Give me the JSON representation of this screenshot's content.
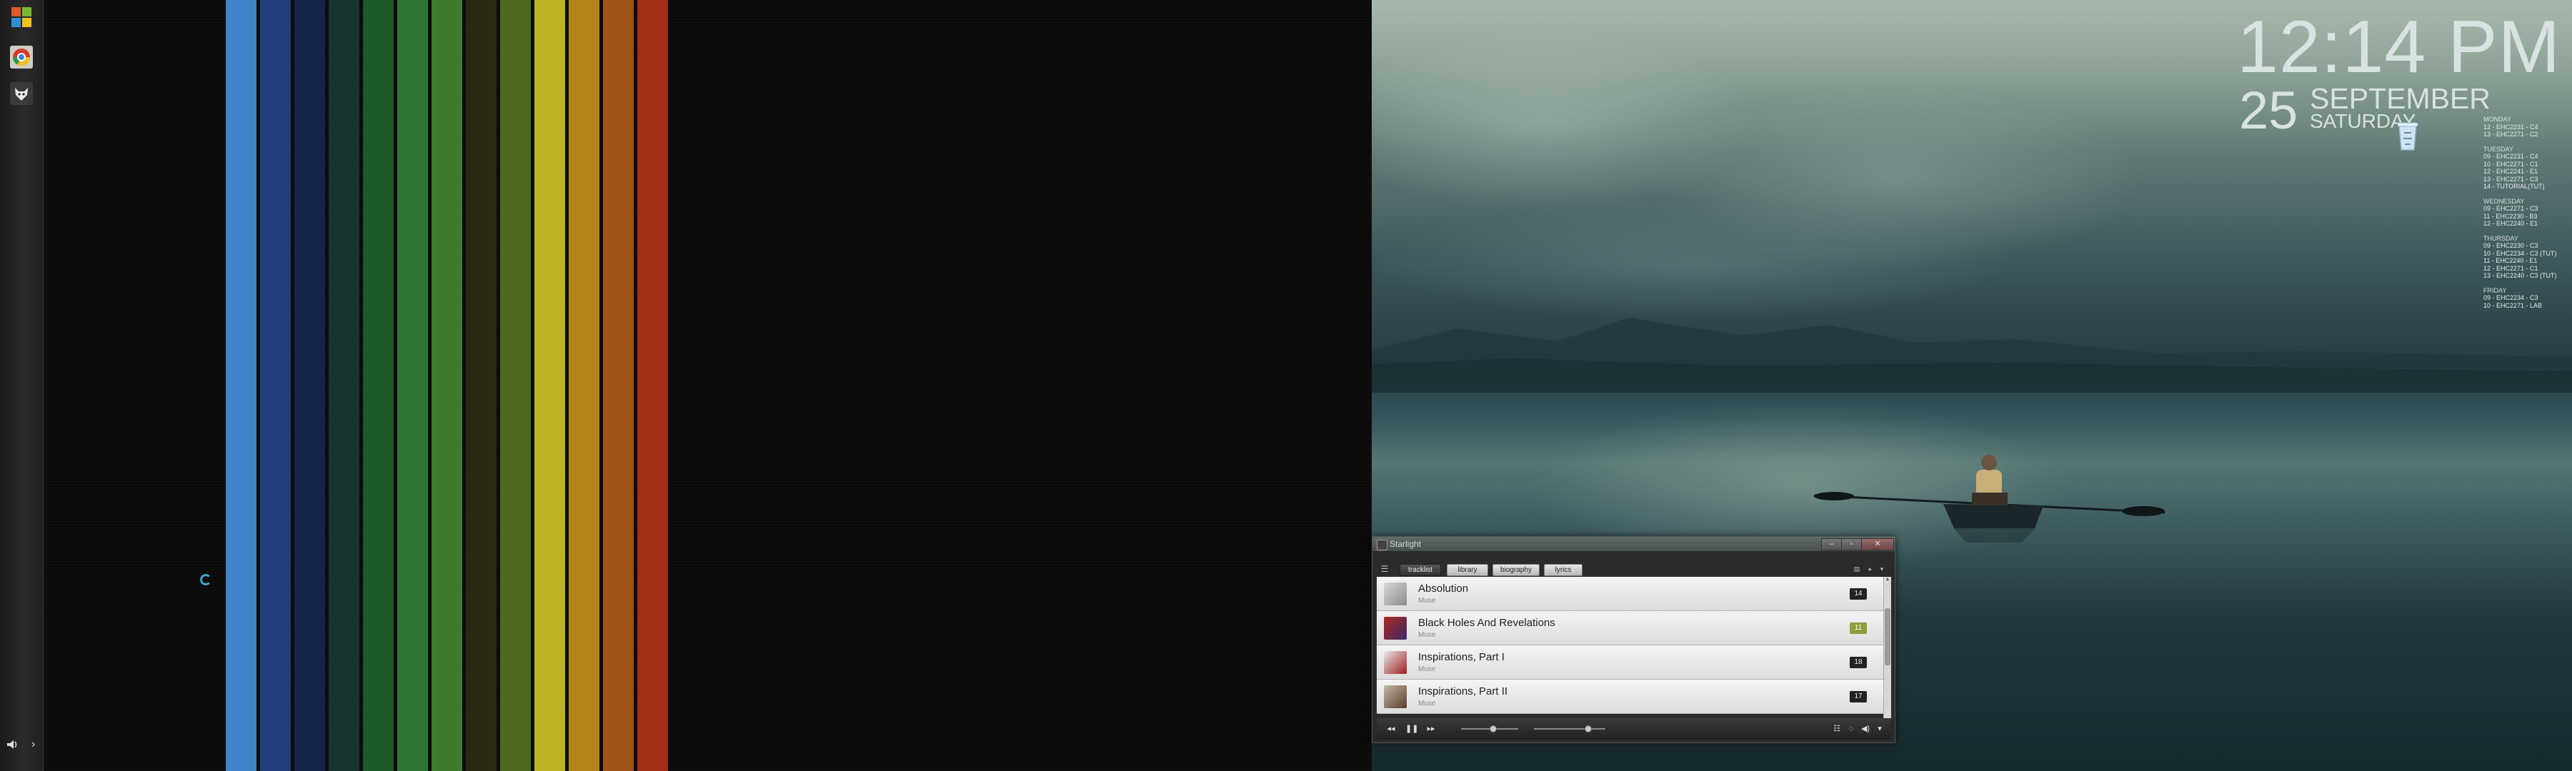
{
  "colors": {
    "stripes": [
      "#3e86c9",
      "#213e7e",
      "#15244b",
      "#16332d",
      "#1c5a2a",
      "#2f7633",
      "#3f7a2c",
      "#2a2a13",
      "#4d6b1c",
      "#bcb222",
      "#b38518",
      "#9f5316",
      "#a32e18"
    ],
    "accent_badge": "#8aa13c"
  },
  "taskbar": {
    "icons": [
      "windows-start-icon",
      "chrome-icon",
      "wolf-app-icon"
    ],
    "tray_volume_icon": "speaker-icon",
    "tray_arrow": "›"
  },
  "clock": {
    "time": "12:14 PM",
    "day": "25",
    "month": "SEPTEMBER",
    "weekday": "SATURDAY"
  },
  "desktop": {
    "icons": [
      "recycle-bin-icon"
    ]
  },
  "schedule": [
    {
      "day": "MONDAY",
      "lines": [
        "12 - EHC2231 - C4",
        "13 - EHC2271 - C2"
      ]
    },
    {
      "day": "TUESDAY",
      "lines": [
        "09 - EHC2231 - C4",
        "10 - EHC2271 - C1",
        "12 - EHC2241 - E1",
        "13 - EHC2271 - C3",
        "14 - TUTORIAL(TUT)"
      ]
    },
    {
      "day": "WEDNESDAY",
      "lines": [
        "09 - EHC2271 - C3",
        "11 - EHC2230 - B3",
        "12 - EHC2240 - E1"
      ]
    },
    {
      "day": "THURSDAY",
      "lines": [
        "09 - EHC2230 - C3",
        "10 - EHC2234 - C3 (TUT)",
        "11 - EHC2240 - E1",
        "12 - EHC2271 - C1",
        "13 - EHC2240 - C3 (TUT)"
      ]
    },
    {
      "day": "FRIDAY",
      "lines": [
        "09 - EHC2234 - C3",
        "10 - EHC2271 - LAB"
      ]
    }
  ],
  "player": {
    "title": "Starlight",
    "window_buttons": {
      "minimize": "–",
      "maximize": "▫",
      "close": "✕"
    },
    "tabs": [
      "tracklist",
      "library",
      "biography",
      "lyrics"
    ],
    "active_tab": "tracklist",
    "tracks": [
      {
        "title": "Absolution",
        "artist": "Muse",
        "count": "14",
        "highlight": false
      },
      {
        "title": "Black Holes And Revelations",
        "artist": "Muse",
        "count": "11",
        "highlight": true
      },
      {
        "title": "Inspirations, Part I",
        "artist": "Muse",
        "count": "18",
        "highlight": false
      },
      {
        "title": "Inspirations, Part II",
        "artist": "Muse",
        "count": "17",
        "highlight": false
      }
    ],
    "controls": {
      "prev": "◂◂",
      "pause": "❚❚",
      "next": "▸▸"
    },
    "seek_fraction": 0.55,
    "volume_fraction": 0.75
  }
}
